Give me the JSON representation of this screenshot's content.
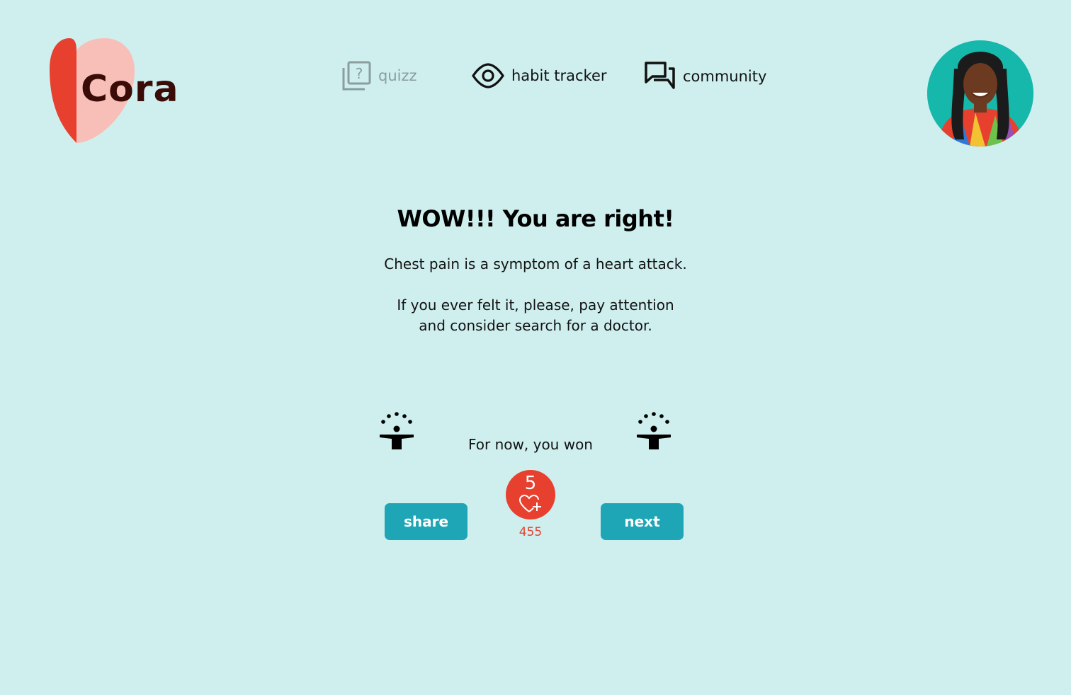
{
  "brand": {
    "name": "Cora"
  },
  "nav": {
    "items": [
      {
        "label": "quizz",
        "icon": "quiz-icon"
      },
      {
        "label": "habit tracker",
        "icon": "eye-icon"
      },
      {
        "label": "community",
        "icon": "chat-icon"
      }
    ]
  },
  "profile": {
    "avatar": "avatar"
  },
  "result": {
    "title": "WOW!!! You are right!",
    "line1": "Chest pain is a symptom of a heart attack.",
    "line2a": "If you ever felt it, please, pay attention",
    "line2b": "and consider search for a doctor."
  },
  "reward": {
    "caption": "For now, you won",
    "points": "5",
    "total": "455"
  },
  "actions": {
    "share": "share",
    "next": "next"
  },
  "colors": {
    "background": "#cfefef",
    "accent": "#1fa6b6",
    "brand_red": "#e8402f",
    "brand_pink": "#f8bfb8",
    "brand_dark": "#3a0b07"
  }
}
